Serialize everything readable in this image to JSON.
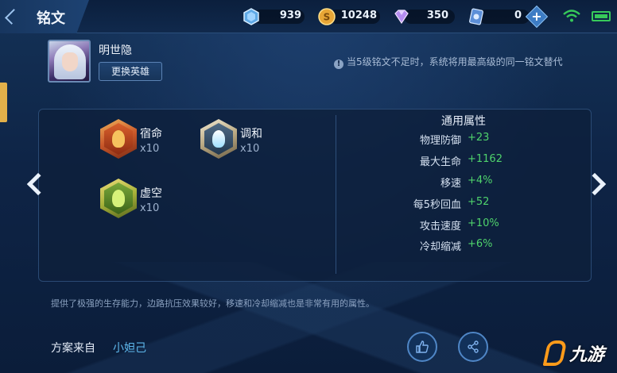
{
  "header": {
    "title": "铭文",
    "resources": {
      "crystal": "939",
      "gold": "10248",
      "diamond": "350",
      "tickets": "0"
    },
    "plus_label": "+"
  },
  "hero": {
    "name": "明世隐",
    "change_button": "更换英雄"
  },
  "hint": {
    "icon": "!",
    "text": "当5级铭文不足时，系统将用最高级的同一铭文替代"
  },
  "runes": [
    {
      "name": "宿命",
      "count": "x10",
      "color": "#c9582a"
    },
    {
      "name": "调和",
      "count": "x10",
      "color": "#9fe0ff"
    },
    {
      "name": "虚空",
      "count": "x10",
      "color": "#a7b23a"
    }
  ],
  "attributes": {
    "title": "通用属性",
    "rows": [
      {
        "key": "物理防御",
        "value": "+23"
      },
      {
        "key": "最大生命",
        "value": "+1162"
      },
      {
        "key": "移速",
        "value": "+4%"
      },
      {
        "key": "每5秒回血",
        "value": "+52"
      },
      {
        "key": "攻击速度",
        "value": "+10%"
      },
      {
        "key": "冷却缩减",
        "value": "+6%"
      }
    ]
  },
  "description": "提供了极强的生存能力，边路抗压效果较好，移速和冷却缩减也是非常有用的属性。",
  "source": {
    "label": "方案来自",
    "name": "小妲己"
  },
  "watermark": {
    "text": "九游"
  },
  "colors": {
    "accent_green": "#4fd36c",
    "link_blue": "#5fb9ee",
    "tab_gold": "#e2b04a"
  }
}
